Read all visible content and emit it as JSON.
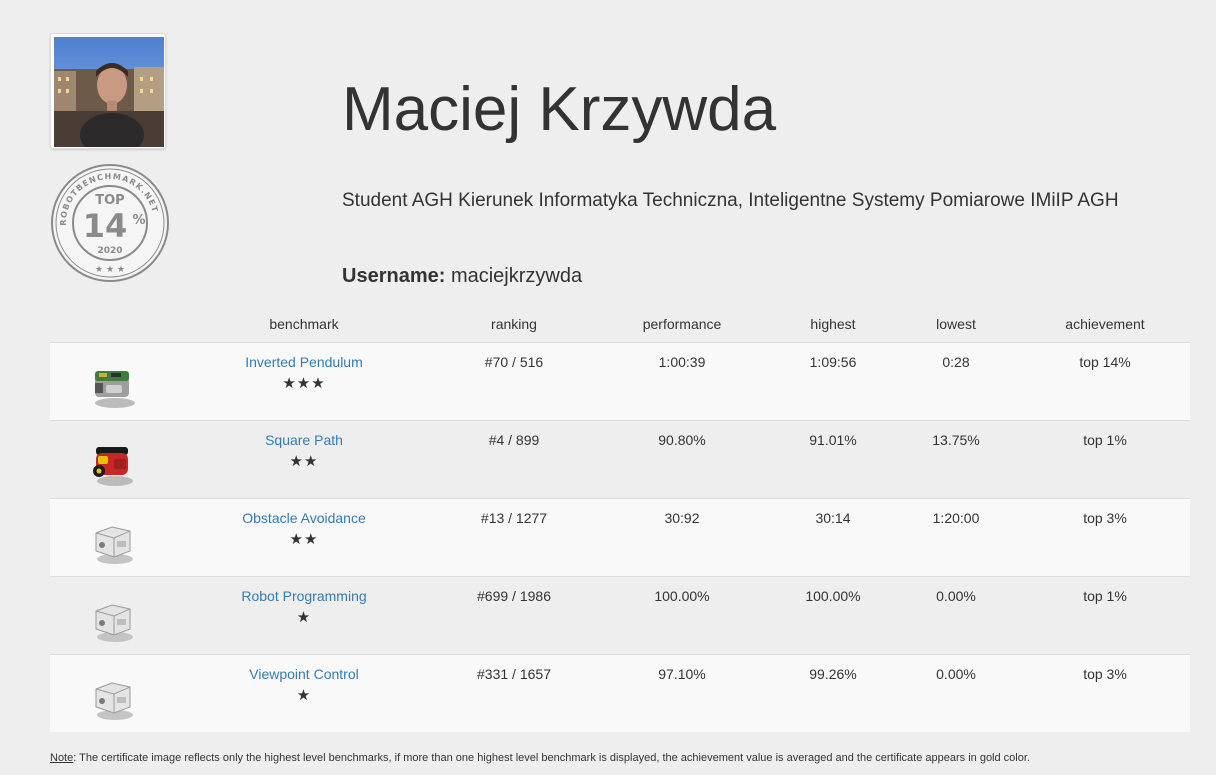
{
  "profile": {
    "name": "Maciej Krzywda",
    "bio": "Student AGH Kierunek Informatyka Techniczna, Inteligentne Systemy Pomiarowe IMiIP AGH",
    "username_label": "Username:",
    "username": "maciejkrzywda"
  },
  "badge": {
    "ring_text": "ROBOTBENCHMARK.NET",
    "top_label": "TOP",
    "percent": "14",
    "percent_sign": "%",
    "year": "2020",
    "stars": "★ ★ ★"
  },
  "table": {
    "headers": {
      "benchmark": "benchmark",
      "ranking": "ranking",
      "performance": "performance",
      "highest": "highest",
      "lowest": "lowest",
      "achievement": "achievement"
    },
    "rows": [
      {
        "robot_icon": "green-robot-icon",
        "benchmark": "Inverted Pendulum",
        "stars": "★★★",
        "ranking": "#70 / 516",
        "performance": "1:00:39",
        "highest": "1:09:56",
        "lowest": "0:28",
        "achievement": "top 14%"
      },
      {
        "robot_icon": "red-robot-icon",
        "benchmark": "Square Path",
        "stars": "★★",
        "ranking": "#4 / 899",
        "performance": "90.80%",
        "highest": "91.01%",
        "lowest": "13.75%",
        "achievement": "top 1%"
      },
      {
        "robot_icon": "grey-robot-icon",
        "benchmark": "Obstacle Avoidance",
        "stars": "★★",
        "ranking": "#13 / 1277",
        "performance": "30:92",
        "highest": "30:14",
        "lowest": "1:20:00",
        "achievement": "top 3%"
      },
      {
        "robot_icon": "grey-robot-icon",
        "benchmark": "Robot Programming",
        "stars": "★",
        "ranking": "#699 / 1986",
        "performance": "100.00%",
        "highest": "100.00%",
        "lowest": "0.00%",
        "achievement": "top 1%"
      },
      {
        "robot_icon": "grey-robot-icon",
        "benchmark": "Viewpoint Control",
        "stars": "★",
        "ranking": "#331 / 1657",
        "performance": "97.10%",
        "highest": "99.26%",
        "lowest": "0.00%",
        "achievement": "top 3%"
      }
    ]
  },
  "note": {
    "label": "Note",
    "text": ": The certificate image reflects only the highest level benchmarks, if more than one highest level benchmark is displayed, the achievement value is averaged and the certificate appears in gold color."
  },
  "colors": {
    "background": "#eeeeee",
    "link": "#337ab7",
    "text": "#333333",
    "badge": "#888888"
  }
}
